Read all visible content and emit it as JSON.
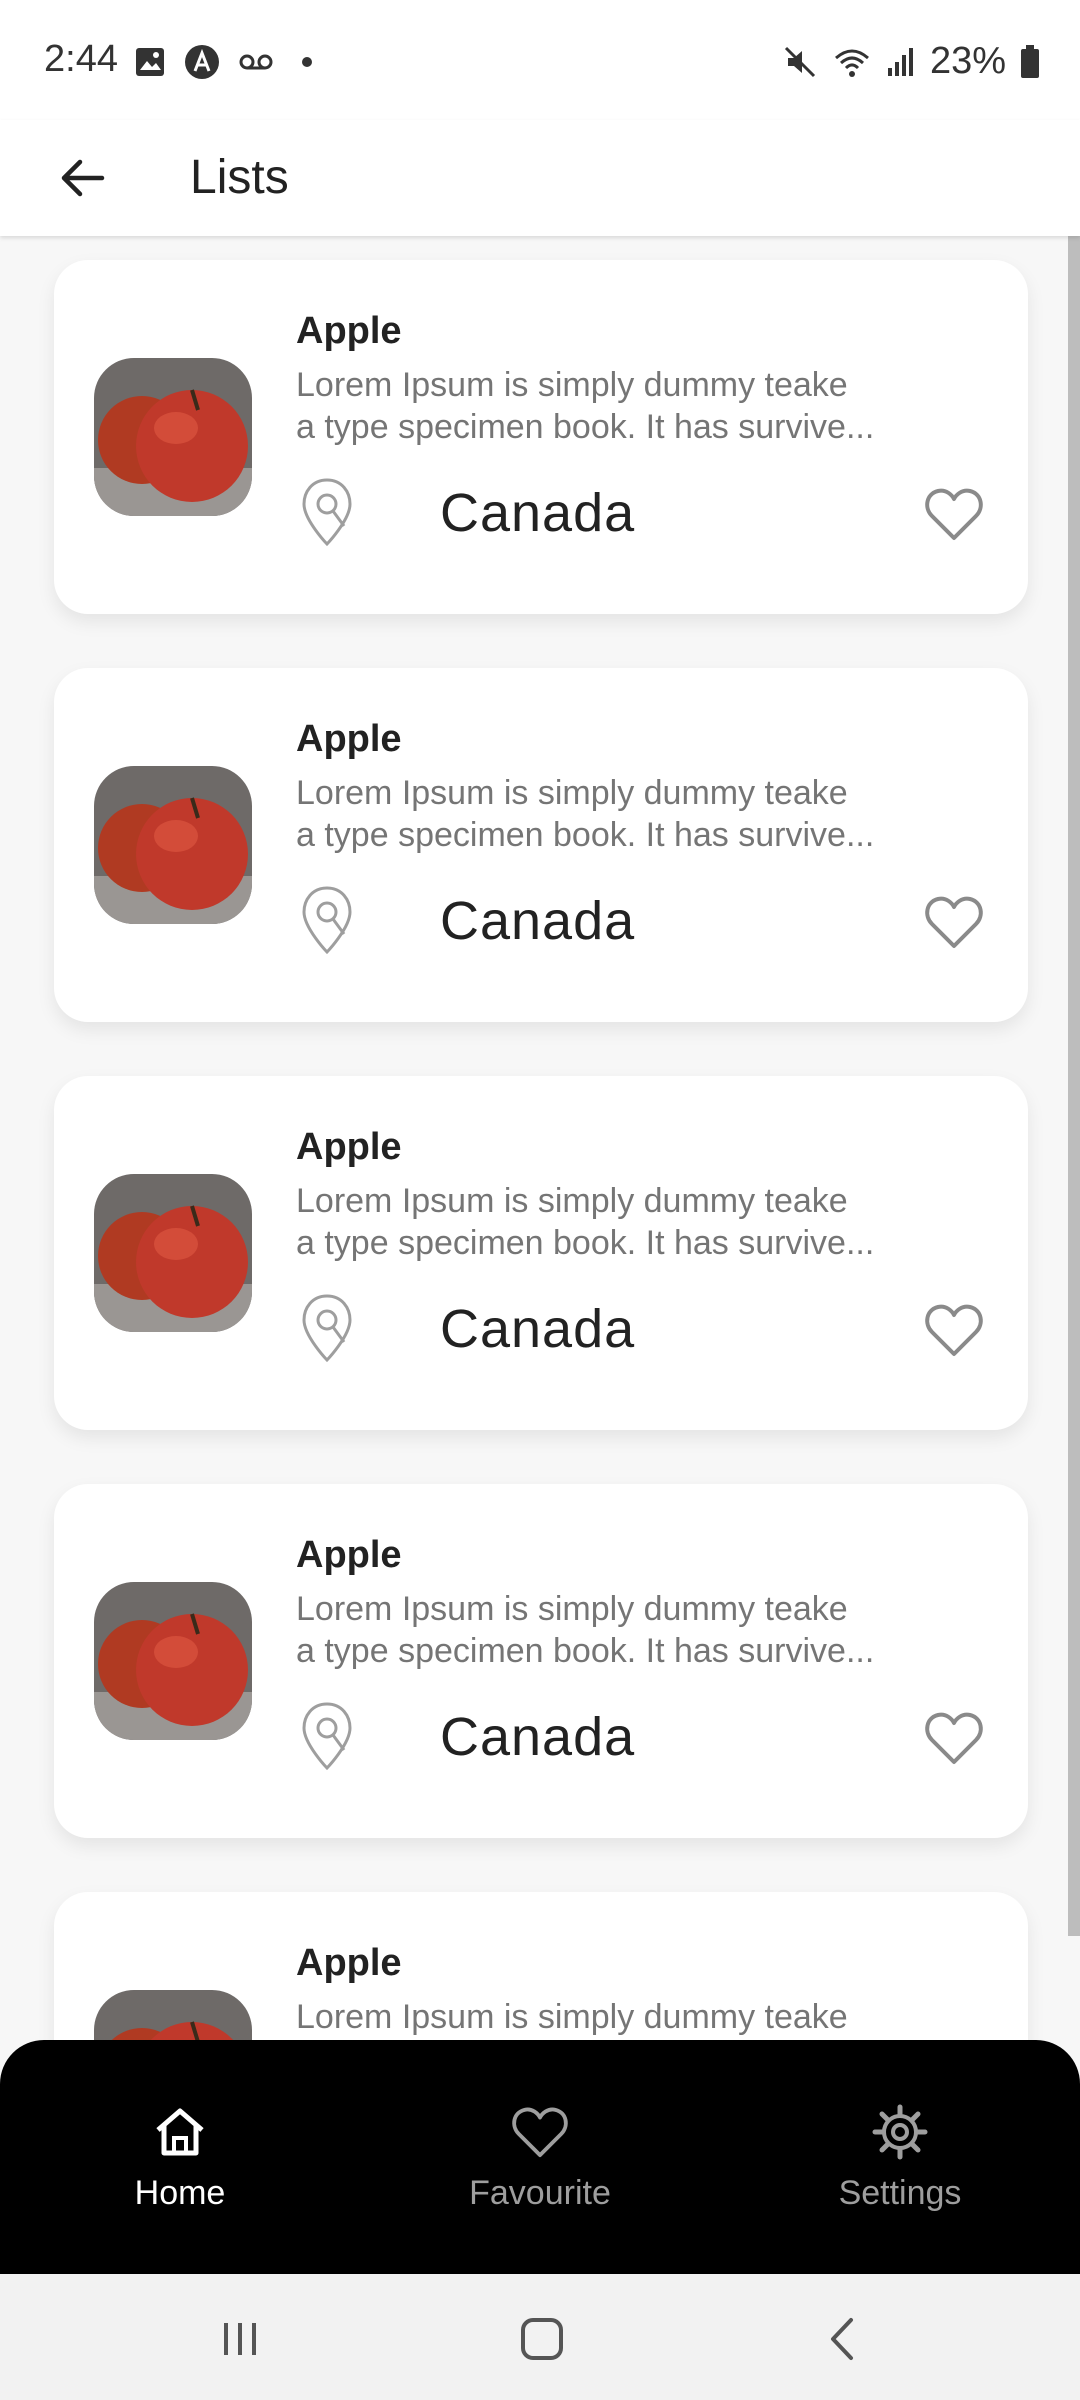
{
  "status_bar": {
    "time": "2:44",
    "battery": "23%",
    "icons_left": [
      "image-icon",
      "a-icon",
      "voicemail-icon"
    ],
    "icons_right": [
      "mute-icon",
      "wifi-icon",
      "signal-icon",
      "battery-icon"
    ]
  },
  "app_bar": {
    "title": "Lists",
    "back_icon": "arrow-left-icon"
  },
  "list": {
    "items": [
      {
        "title": "Apple",
        "desc_line1": "Lorem Ipsum is simply dummy teake",
        "desc_line2": "a type specimen book. It has survive...",
        "location": "Canada"
      },
      {
        "title": "Apple",
        "desc_line1": "Lorem Ipsum is simply dummy teake",
        "desc_line2": "a type specimen book. It has survive...",
        "location": "Canada"
      },
      {
        "title": "Apple",
        "desc_line1": "Lorem Ipsum is simply dummy teake",
        "desc_line2": "a type specimen book. It has survive...",
        "location": "Canada"
      },
      {
        "title": "Apple",
        "desc_line1": "Lorem Ipsum is simply dummy teake",
        "desc_line2": "a type specimen book. It has survive...",
        "location": "Canada"
      },
      {
        "title": "Apple",
        "desc_line1": "Lorem Ipsum is simply dummy teake",
        "desc_line2": "",
        "location": ""
      }
    ]
  },
  "bottom_nav": {
    "items": [
      {
        "label": "Home",
        "icon": "home-icon",
        "active": true
      },
      {
        "label": "Favourite",
        "icon": "heart-icon",
        "active": false
      },
      {
        "label": "Settings",
        "icon": "gear-icon",
        "active": false
      }
    ]
  },
  "colors": {
    "nav_bg": "#000000",
    "nav_active": "#ffffff",
    "nav_inactive": "#9e9e9e",
    "card_bg": "#ffffff",
    "page_bg": "#f7f7f7"
  }
}
